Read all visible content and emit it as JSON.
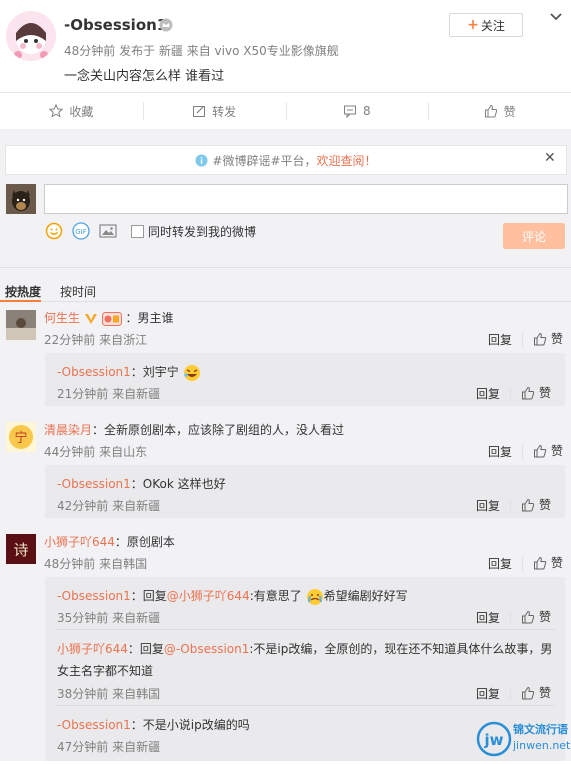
{
  "post": {
    "username": "-Obsession1",
    "meta": "48分钟前 发布于 新疆 来自 vivo X50专业影像旗舰",
    "text": "一念关山内容怎么样 谁看过",
    "follow_label": "关注"
  },
  "actions": {
    "favorite": "收藏",
    "repost": "转发",
    "comment_count": "8",
    "like": "赞"
  },
  "notice": {
    "prefix": "#微博辟谣#平台，",
    "highlight": "欢迎查阅！"
  },
  "composer": {
    "placeholder": "",
    "repost_option": "同时转发到我的微博",
    "submit": "评论"
  },
  "sort": {
    "hot": "按热度",
    "time": "按时间"
  },
  "common": {
    "reply": "回复",
    "like": "赞"
  },
  "comments": [
    {
      "user": "何生生",
      "text": "：男主谁",
      "time": "22分钟前 来自浙江",
      "replies": [
        {
          "user": "-Obsession1",
          "text": "：刘宇宁",
          "time": "21分钟前 来自新疆"
        }
      ]
    },
    {
      "user": "清晨染月",
      "text": "：全新原创剧本，应该除了剧组的人，没人看过",
      "time": "44分钟前 来自山东",
      "replies": [
        {
          "user": "-Obsession1",
          "text": "：OKok 这样也好",
          "time": "42分钟前 来自新疆"
        }
      ]
    },
    {
      "user": "小狮子吖644",
      "text": "：原创剧本",
      "time": "48分钟前 来自韩国",
      "replies": [
        {
          "user": "-Obsession1",
          "pre": "：回复",
          "mention": "@小狮子吖644",
          "text": ":有意思了",
          "text2": "希望编剧好好写",
          "time": "35分钟前 来自新疆"
        },
        {
          "user": "小狮子吖644",
          "pre": "：回复",
          "mention": "@-Obsession1",
          "text": ":不是ip改编，全原创的，现在还不知道具体什么故事，男",
          "text_line2": "女主名字都不知道",
          "time": "38分钟前 来自韩国"
        },
        {
          "user": "-Obsession1",
          "text": "：不是小说ip改编的吗",
          "time": "47分钟前 来自新疆"
        }
      ]
    }
  ],
  "watermark": {
    "brand": "锦文流行语",
    "url": "jinwen.net"
  },
  "colors": {
    "accent": "#eb7350",
    "submit_disabled": "#ffc09f",
    "sort_active": "#fa7d3c"
  }
}
